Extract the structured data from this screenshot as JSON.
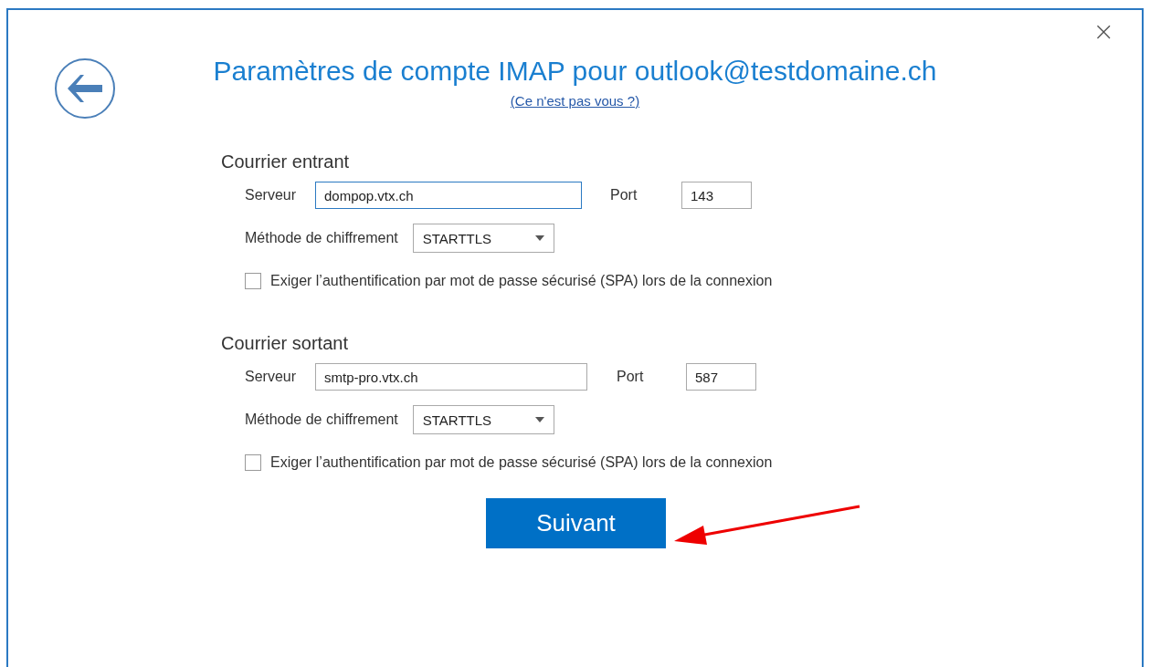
{
  "window": {
    "close_label": "×"
  },
  "header": {
    "title": "Paramètres de compte IMAP pour outlook@testdomaine.ch",
    "link": "(Ce n'est pas vous ?)"
  },
  "sections": [
    {
      "heading": "Courrier entrant",
      "server_label": "Serveur",
      "server_value": "dompop.vtx.ch",
      "server_focused": true,
      "port_label": "Port",
      "port_value": "143",
      "method_label": "Méthode de chiffrement",
      "method_value": "STARTTLS",
      "spa_label": "Exiger l’authentification par mot de passe sécurisé (SPA) lors de la connexion",
      "spa_checked": false
    },
    {
      "heading": "Courrier sortant",
      "server_label": "Serveur",
      "server_value": "smtp-pro.vtx.ch",
      "server_focused": false,
      "port_label": "Port",
      "port_value": "587",
      "method_label": "Méthode de chiffrement",
      "method_value": "STARTTLS",
      "spa_label": "Exiger l’authentification par mot de passe sécurisé (SPA) lors de la connexion",
      "spa_checked": false
    }
  ],
  "next_button": "Suivant",
  "annotation": {
    "kind": "arrow"
  }
}
